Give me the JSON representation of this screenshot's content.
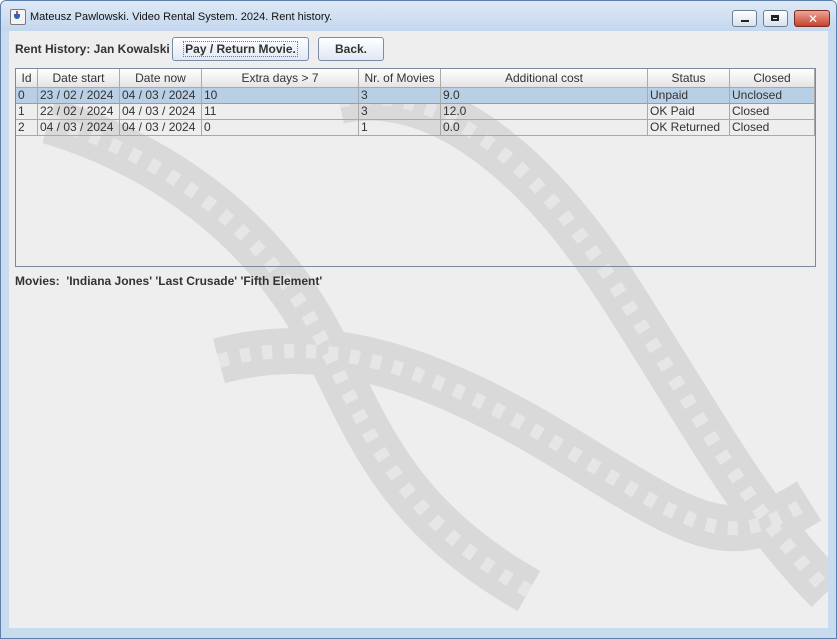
{
  "window": {
    "title": "Mateusz Pawlowski. Video Rental System. 2024. Rent history."
  },
  "toolbar": {
    "rent_history_label": "Rent History: Jan Kowalski",
    "pay_return_button": "Pay / Return Movie.",
    "back_button": "Back."
  },
  "table": {
    "columns": [
      "Id",
      "Date start",
      "Date now",
      "Extra days > 7",
      "Nr. of Movies",
      "Additional cost",
      "Status",
      "Closed"
    ],
    "rows": [
      [
        "0",
        "23 / 02 / 2024",
        "04 / 03 / 2024",
        "10",
        "3",
        "9.0",
        "Unpaid",
        "Unclosed"
      ],
      [
        "1",
        "22 / 02 / 2024",
        "04 / 03 / 2024",
        "11",
        "3",
        "12.0",
        "OK Paid",
        "Closed"
      ],
      [
        "2",
        "04 / 03 / 2024",
        "04 / 03 / 2024",
        "0",
        "1",
        "0.0",
        "OK Returned",
        "Closed"
      ]
    ],
    "selected_row": 0
  },
  "movies": {
    "text": "Movies:  'Indiana Jones' 'Last Crusade' 'Fifth Element'"
  },
  "colors": {
    "title_bar": "#c9dbef",
    "selection": "#b8cfe5",
    "panel": "#eeeeee",
    "close_button": "#c9412d"
  }
}
